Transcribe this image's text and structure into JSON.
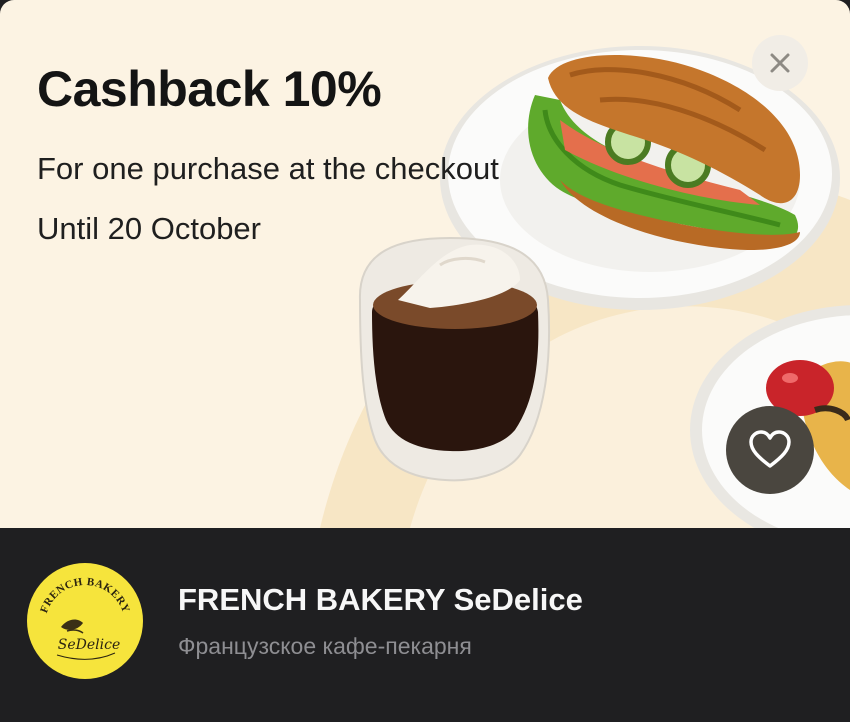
{
  "promo": {
    "title": "Cashback 10%",
    "subtitle": "For one purchase at the checkout",
    "until": "Until 20 October",
    "background_color": "#fcf3e3"
  },
  "actions": {
    "close_icon": "close-icon",
    "favorite_icon": "heart-outline-icon"
  },
  "business": {
    "name": "FRENCH BAKERY SeDelice",
    "description": "Французское кафе-пекарня",
    "logo_text_top": "FRENCH BAKERY",
    "logo_script": "SeDelice",
    "logo_color": "#f6e43c"
  },
  "colors": {
    "footer_background": "#1f1f21",
    "title_text": "#141414",
    "description_text": "#8e8e92"
  }
}
